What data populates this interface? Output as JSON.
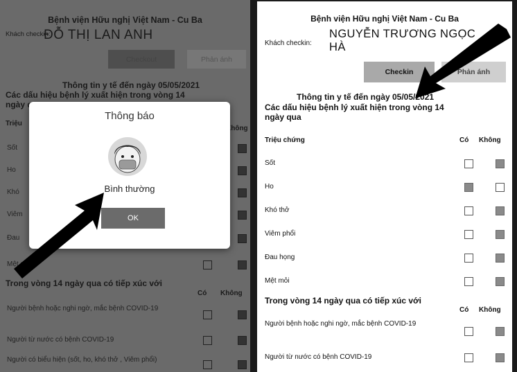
{
  "left": {
    "title": "Bệnh viện Hữu nghị Việt Nam - Cu Ba",
    "guest_label": "Khách checkin:",
    "guest_name": "ĐỖ THỊ LAN ANH",
    "checkout_label": "Checkout",
    "phananh_label": "Phản ánh",
    "section_title": "Thông tin y tế đến ngày 05/05/2021",
    "symptoms_title": "Các dấu hiệu bệnh lý xuất hiện trong vòng 14",
    "symptoms_title_2": "ngày qua",
    "col_trieu": "Triệu",
    "col_khong": "Không",
    "rows": [
      "Sốt",
      "Ho",
      "Khó",
      "Viêm",
      "Đau",
      "Mệt mỏi"
    ],
    "contact_title": "Trong vòng 14 ngày qua có tiếp xúc với",
    "col_co": "Có",
    "col_khong2": "Không",
    "contact_rows": [
      "Người bệnh hoặc nghi ngờ, mắc bệnh COVID-19",
      "Người từ nước có bệnh COVID-19",
      "Người có biểu hiện (sốt, ho, khó thở , Viêm phổi)"
    ],
    "modal": {
      "title": "Thông báo",
      "message": "Bình thường",
      "ok_label": "OK"
    }
  },
  "right": {
    "title": "Bệnh viện Hữu nghị Việt Nam - Cu Ba",
    "guest_label": "Khách checkin:",
    "guest_name_1": "NGUYỄN TRƯƠNG NGỌC",
    "guest_name_2": "HÀ",
    "checkin_label": "Checkin",
    "phananh_label": "Phản ánh",
    "section_title": "Thông tin y tế đến ngày 05/05/2021",
    "symptoms_title": "Các dấu hiệu bệnh lý xuất hiện trong vòng 14",
    "symptoms_title_2": "ngày qua",
    "col_trieu": "Triệu chứng",
    "col_co": "Có",
    "col_khong": "Không",
    "rows": [
      "Sốt",
      "Ho",
      "Khó thở",
      "Viêm phổi",
      "Đau họng",
      "Mệt mỏi"
    ],
    "contact_title": "Trong vòng 14 ngày qua có tiếp xúc với",
    "col_co2": "Có",
    "col_khong2": "Không",
    "contact_rows": [
      "Người bệnh hoặc nghi ngờ, mắc bệnh COVID-19",
      "Người từ nước có bệnh COVID-19"
    ]
  }
}
